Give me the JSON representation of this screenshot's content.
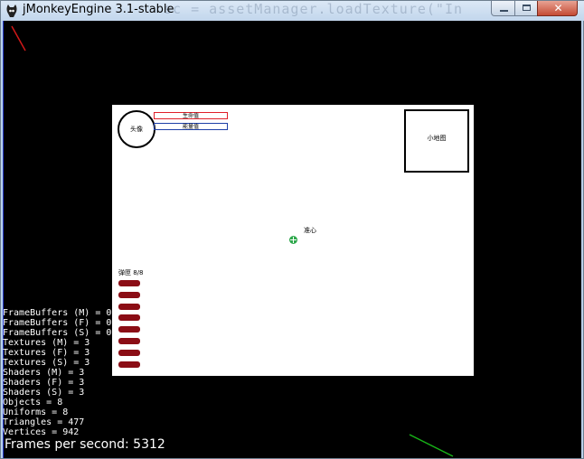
{
  "window": {
    "title": "jMonkeyEngine 3.1-stable",
    "background_code": "sc = assetManager.loadTexture(\"In",
    "buttons": {
      "close_glyph": "✕"
    }
  },
  "hud": {
    "avatar_label": "头像",
    "hp_label": "生命值",
    "mp_label": "能量值",
    "minimap_label": "小地图",
    "crosshair_label": "准心",
    "ammo_label": "弹匣 8/8",
    "ammo": {
      "current": 8,
      "max": 8
    },
    "colors": {
      "hp": "#e0202a",
      "mp": "#1d3fa8",
      "ammo": "#8b0d15",
      "crosshair": "#2ea84c"
    }
  },
  "stats": {
    "lines": [
      "FrameBuffers (M) = 0",
      "FrameBuffers (F) = 0",
      "FrameBuffers (S) = 0",
      "Textures (M) = 3",
      "Textures (F) = 3",
      "Textures (S) = 3",
      "Shaders (M) = 3",
      "Shaders (F) = 3",
      "Shaders (S) = 3",
      "Objects = 8",
      "Uniforms = 8",
      "Triangles = 477",
      "Vertices = 942"
    ],
    "fps_text": "Frames per second: 5312"
  }
}
